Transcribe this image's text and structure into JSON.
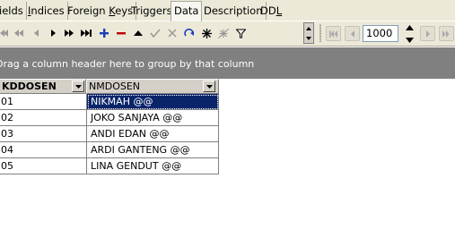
{
  "tabs": [
    {
      "label": "ields",
      "active": false
    },
    {
      "label": "Indices",
      "active": false
    },
    {
      "label": "Foreign Keys",
      "active": false
    },
    {
      "label": "Triggers",
      "active": false
    },
    {
      "label": "Data",
      "active": true
    },
    {
      "label": "Description",
      "active": false
    },
    {
      "label": "DDL",
      "active": false
    }
  ],
  "toolbar": {
    "icons": [
      "first-record-icon",
      "prior-page-icon",
      "prior-record-icon",
      "next-record-icon",
      "next-page-icon",
      "last-record-icon",
      "insert-record-icon",
      "delete-record-icon",
      "edit-record-icon",
      "post-edit-icon",
      "cancel-edit-icon",
      "refresh-icon",
      "commit-icon",
      "rollback-icon",
      "filter-icon"
    ],
    "limit_value": "1000"
  },
  "group_panel": {
    "text": "Drag a column header here to group by that column"
  },
  "grid": {
    "columns": [
      "KDDOSEN",
      "NMDOSEN"
    ],
    "rows": [
      [
        "01",
        "NIKMAH @@"
      ],
      [
        "02",
        "JOKO SANJAYA @@"
      ],
      [
        "03",
        "ANDI EDAN @@"
      ],
      [
        "04",
        "ARDI GANTENG @@"
      ],
      [
        "05",
        "LINA GENDUT @@"
      ]
    ],
    "selected_row": 0,
    "selected_column": 1
  },
  "colors": {
    "panel_bg": "#ece9d8",
    "group_bg": "#808080",
    "selection": "#0a246a",
    "insert_icon": "#1a3fb8",
    "delete_icon": "#c00000"
  }
}
